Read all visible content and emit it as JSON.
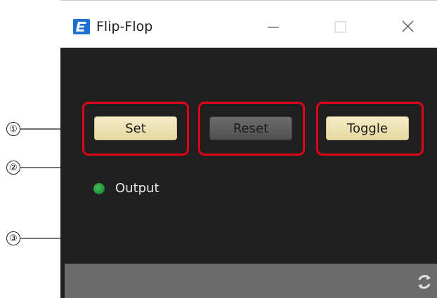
{
  "window": {
    "title": "Flip-Flop",
    "icon": "app-e-icon",
    "controls": [
      "minimize-icon",
      "maximize-icon",
      "close-icon"
    ]
  },
  "buttons": {
    "set": "Set",
    "reset": "Reset",
    "toggle": "Toggle"
  },
  "output": {
    "label": "Output",
    "led_color": "#2ea44a",
    "state": "on"
  },
  "callouts": [
    "①",
    "②",
    "③"
  ],
  "colors": {
    "highlight": "#e2001a",
    "panel_bg": "#202020",
    "button_active": "#efe5b8",
    "button_inactive": "#5e5e5e"
  },
  "footer": {
    "icon": "refresh-icon"
  }
}
